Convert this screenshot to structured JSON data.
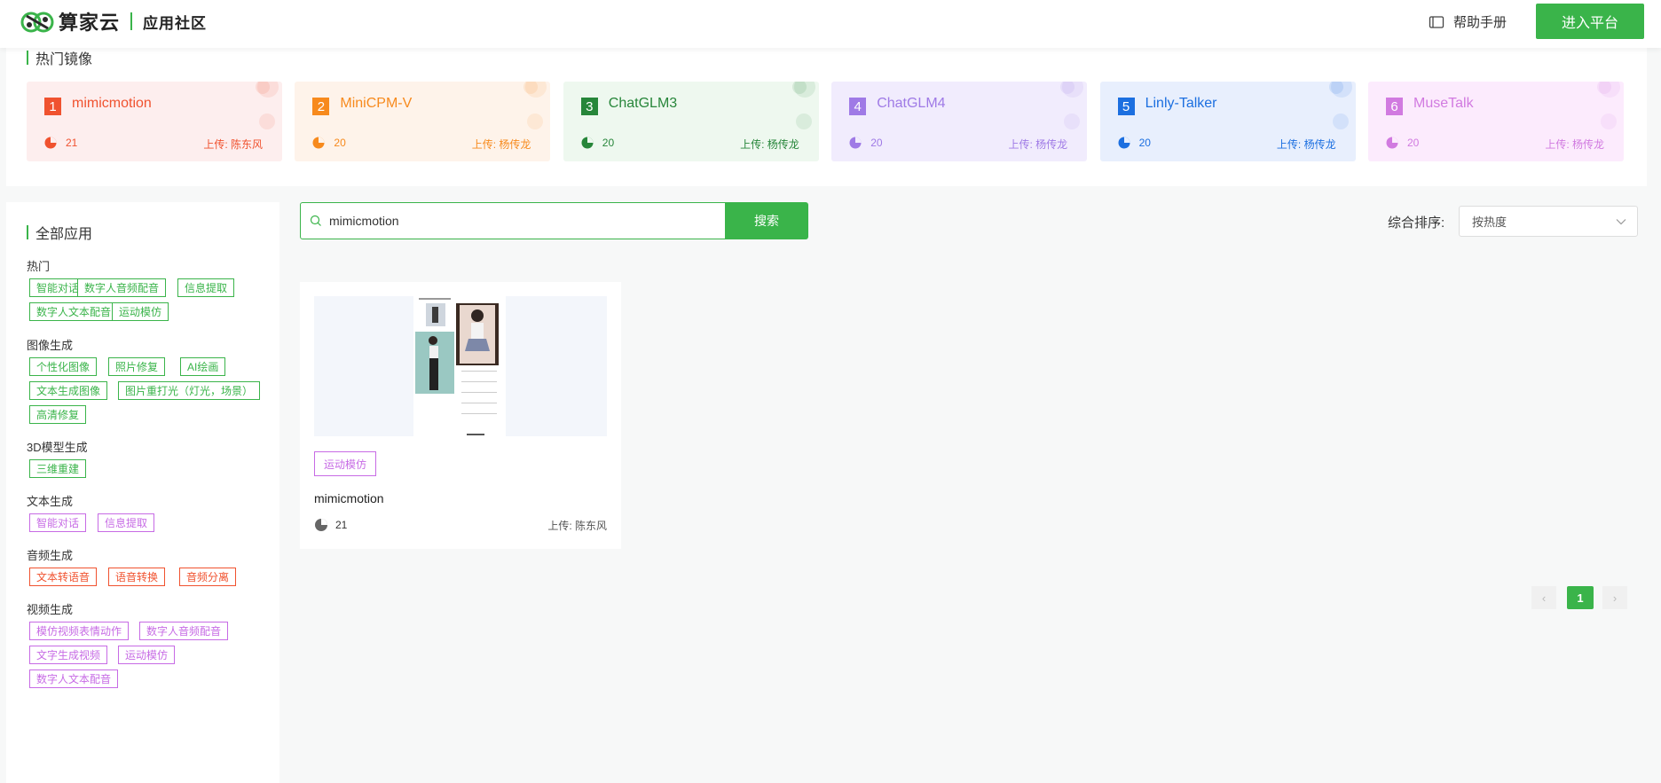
{
  "header": {
    "brand": "算家云",
    "subtitle": "应用社区",
    "help_label": "帮助手册",
    "enter_label": "进入平台"
  },
  "hot": {
    "title": "热门镜像",
    "items": [
      {
        "rank": "1",
        "name": "mimicmotion",
        "count": "21",
        "uploader": "上传: 陈东风",
        "color": "#f0522f",
        "bg": "#fdeeee"
      },
      {
        "rank": "2",
        "name": "MiniCPM-V",
        "count": "20",
        "uploader": "上传: 杨传龙",
        "color": "#f78a1d",
        "bg": "#fef3ea"
      },
      {
        "rank": "3",
        "name": "ChatGLM3",
        "count": "20",
        "uploader": "上传: 杨传龙",
        "color": "#27863a",
        "bg": "#eef8ef"
      },
      {
        "rank": "4",
        "name": "ChatGLM4",
        "count": "20",
        "uploader": "上传: 杨传龙",
        "color": "#9f7ae6",
        "bg": "#f1ecfd"
      },
      {
        "rank": "5",
        "name": "Linly-Talker",
        "count": "20",
        "uploader": "上传: 杨传龙",
        "color": "#1c6fe0",
        "bg": "#e8effd"
      },
      {
        "rank": "6",
        "name": "MuseTalk",
        "count": "20",
        "uploader": "上传: 杨传龙",
        "color": "#d17ae0",
        "bg": "#fcebfd"
      }
    ]
  },
  "sidebar": {
    "title": "全部应用",
    "categories": [
      {
        "name": "热门",
        "tags": [
          "智能对话",
          "数字人音频配音",
          "信息提取",
          "数字人文本配音",
          "运动模仿"
        ]
      },
      {
        "name": "图像生成",
        "tags": [
          "个性化图像",
          "照片修复",
          "AI绘画",
          "文本生成图像",
          "图片重打光（灯光，场景）",
          "高清修复"
        ]
      },
      {
        "name": "3D模型生成",
        "tags": [
          "三维重建"
        ]
      },
      {
        "name": "文本生成",
        "tags": [
          "智能对话",
          "信息提取"
        ]
      },
      {
        "name": "音频生成",
        "tags": [
          "文本转语音",
          "语音转换",
          "音频分离"
        ]
      },
      {
        "name": "视频生成",
        "tags": [
          "模仿视频表情动作",
          "数字人音频配音",
          "文字生成视频",
          "运动模仿",
          "数字人文本配音"
        ]
      }
    ]
  },
  "search": {
    "value": "mimicmotion",
    "button_label": "搜索"
  },
  "sort": {
    "label": "综合排序:",
    "selected": "按热度"
  },
  "results": [
    {
      "tag": "运动模仿",
      "title": "mimicmotion",
      "count": "21",
      "uploader": "上传: 陈东风"
    }
  ],
  "pagination": {
    "prev": "‹",
    "current": "1",
    "next": "›"
  },
  "colors": {
    "accent": "#3ab44a",
    "tag_green": "#3ab44a",
    "tag_purple": "#c76be5",
    "tag_red": "#f0522f"
  }
}
